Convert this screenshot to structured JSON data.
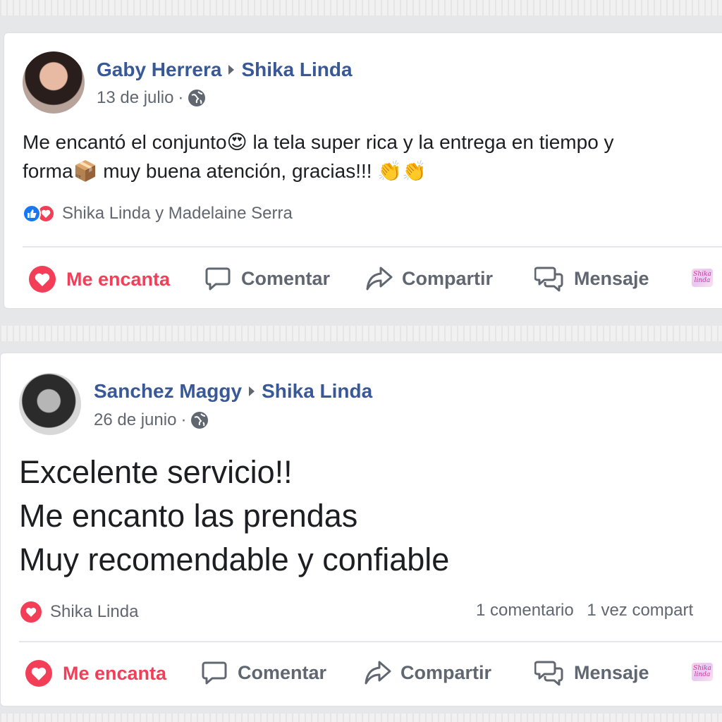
{
  "posts": [
    {
      "author": "Gaby Herrera",
      "page": "Shika Linda",
      "date": "13 de julio",
      "separator": "·",
      "lines": [
        "Me encantó el conjunto😍 la tela super rica y la entrega en tiempo y",
        "forma📦 muy buena atención, gracias!!! 👏👏"
      ],
      "reactions_text": "Shika Linda y Madelaine Serra",
      "comments_count": "",
      "shares_count": "",
      "actions": {
        "love": "Me encanta",
        "comment": "Comentar",
        "share": "Compartir",
        "message": "Mensaje"
      },
      "logo_text": "Shika linda"
    },
    {
      "author": "Sanchez Maggy",
      "page": "Shika Linda",
      "date": "26 de junio",
      "separator": "·",
      "lines": [
        "Excelente servicio!!",
        "Me encanto las prendas",
        "Muy recomendable y confiable"
      ],
      "reactions_text": "Shika Linda",
      "comments_count": "1 comentario",
      "shares_count": "1 vez compart",
      "actions": {
        "love": "Me encanta",
        "comment": "Comentar",
        "share": "Compartir",
        "message": "Mensaje"
      },
      "logo_text": "Shika linda"
    }
  ],
  "colors": {
    "name_blue": "#385898",
    "love_red": "#f33e58",
    "like_blue": "#1877f2",
    "meta_gray": "#606770"
  },
  "icons": [
    "globe-icon",
    "like-reaction-icon",
    "love-reaction-icon",
    "heart-icon",
    "comment-icon",
    "share-icon",
    "message-icon"
  ]
}
